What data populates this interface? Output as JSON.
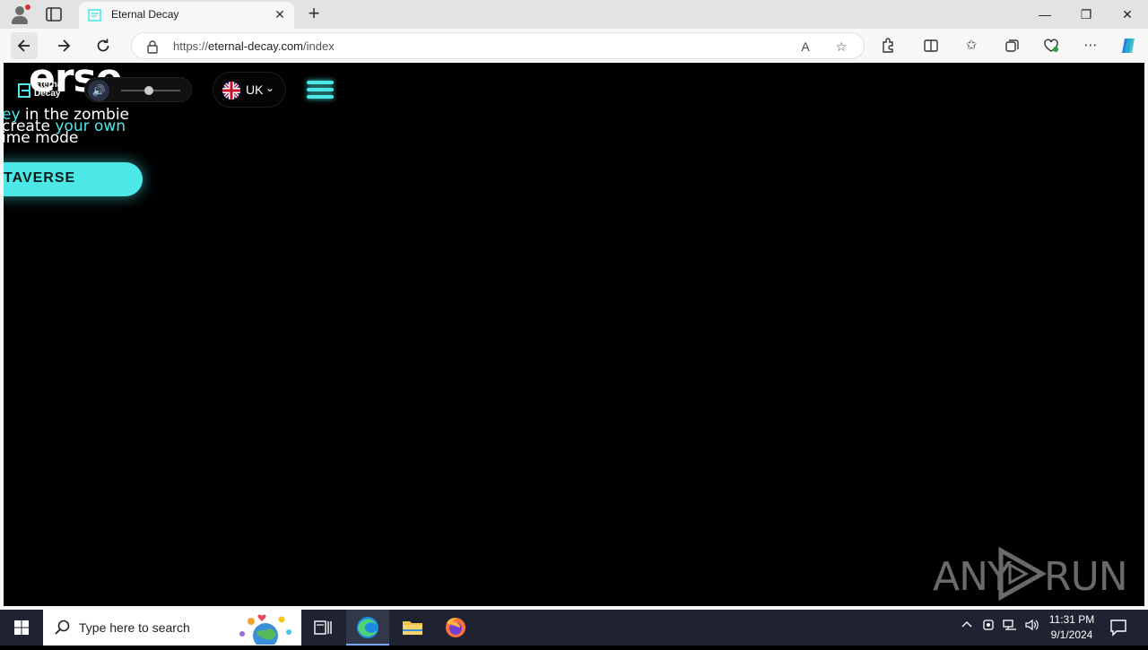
{
  "browser": {
    "tab": {
      "title": "Eternal Decay",
      "close_glyph": "✕"
    },
    "new_tab_glyph": "+",
    "window_controls": {
      "minimize": "—",
      "restore": "❐",
      "close": "✕"
    },
    "address": {
      "url_prefix": "https://",
      "url_host": "eternal-decay.com",
      "url_path": "/index"
    }
  },
  "page": {
    "big_text": "erse",
    "logo_text": "Eternal Decay",
    "lang_code": "UK",
    "lang_chevron": "⌄",
    "hero": {
      "line1_hl": "ey",
      "line1_rest": " in the zombie",
      "line2_start": "create ",
      "line2_hl": "your own",
      "line3": "ime mode"
    },
    "cta_label": "TAVERSE",
    "watermark_left": "ANY",
    "watermark_right": "RUN"
  },
  "taskbar": {
    "search_placeholder": "Type here to search",
    "time": "11:31 PM",
    "date": "9/1/2024"
  },
  "colors": {
    "accent": "#4ce7e7",
    "taskbar": "#1f2230",
    "tab_strip": "#e3e3e3"
  }
}
